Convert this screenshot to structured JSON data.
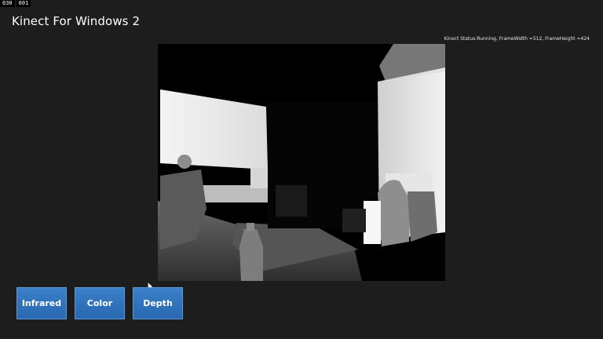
{
  "fps_counter": {
    "left_value": "030",
    "right_value": "001"
  },
  "app": {
    "title": "Kinect For Windows 2"
  },
  "status": {
    "text": "Kinect Status:Running, FrameWidth =512, FrameHeight =424"
  },
  "viewer": {
    "mode": "depth-image"
  },
  "buttons": {
    "infrared_label": "Infrared",
    "color_label": "Color",
    "depth_label": "Depth"
  },
  "colors": {
    "background": "#1d1d1d",
    "button_blue": "#2f74bd"
  }
}
